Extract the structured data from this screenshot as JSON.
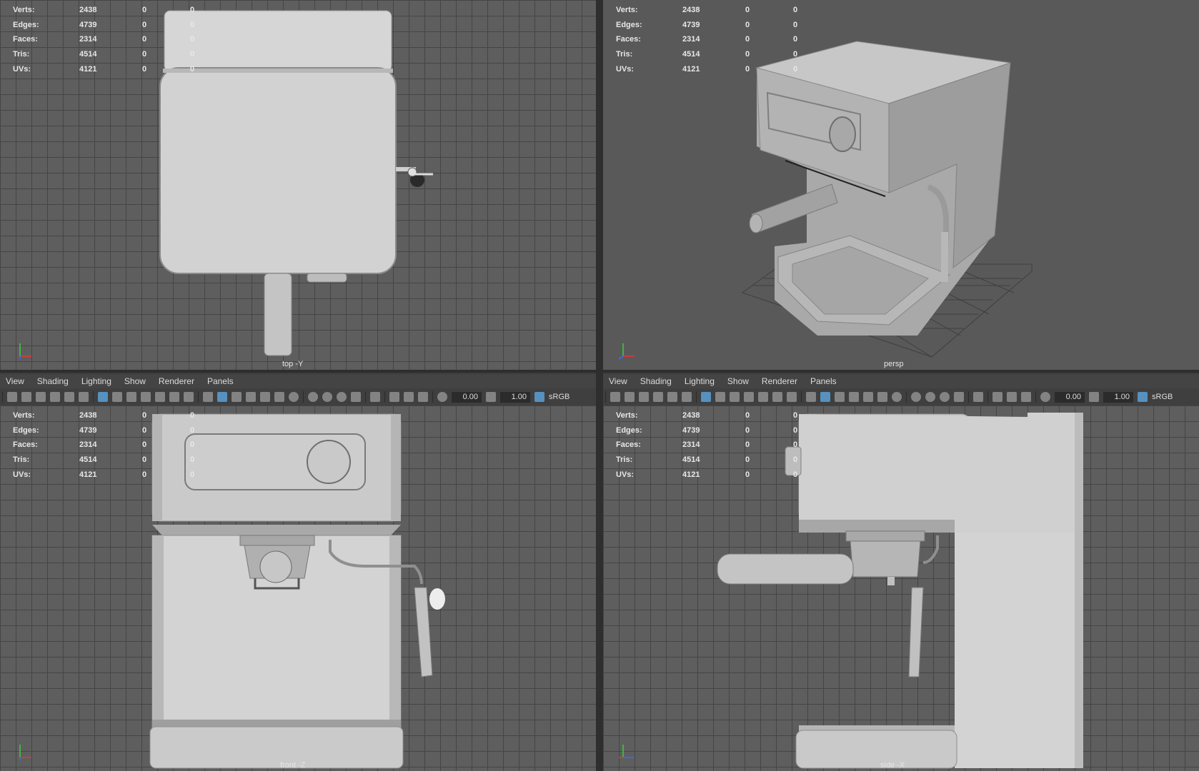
{
  "stats": {
    "labels": [
      "Verts:",
      "Edges:",
      "Faces:",
      "Tris:",
      "UVs:"
    ],
    "values": [
      "2438",
      "4739",
      "2314",
      "4514",
      "4121"
    ],
    "col2": [
      "0",
      "0",
      "0",
      "0",
      "0"
    ],
    "col3": [
      "0",
      "0",
      "0",
      "0",
      "0"
    ]
  },
  "viewports": {
    "top": {
      "label": "top -Y"
    },
    "persp": {
      "label": "persp"
    },
    "front": {
      "label": "front -Z"
    },
    "side": {
      "label": "side -X"
    }
  },
  "menu": [
    "View",
    "Shading",
    "Lighting",
    "Show",
    "Renderer",
    "Panels"
  ],
  "toolbar": {
    "exposure": "0.00",
    "gamma": "1.00",
    "colorspace": "sRGB"
  },
  "colors": {
    "grid_bg": "#5e5e5e",
    "persp_bg": "#595959",
    "model": "#cfcfcf",
    "accent": "#5aa0d6"
  }
}
